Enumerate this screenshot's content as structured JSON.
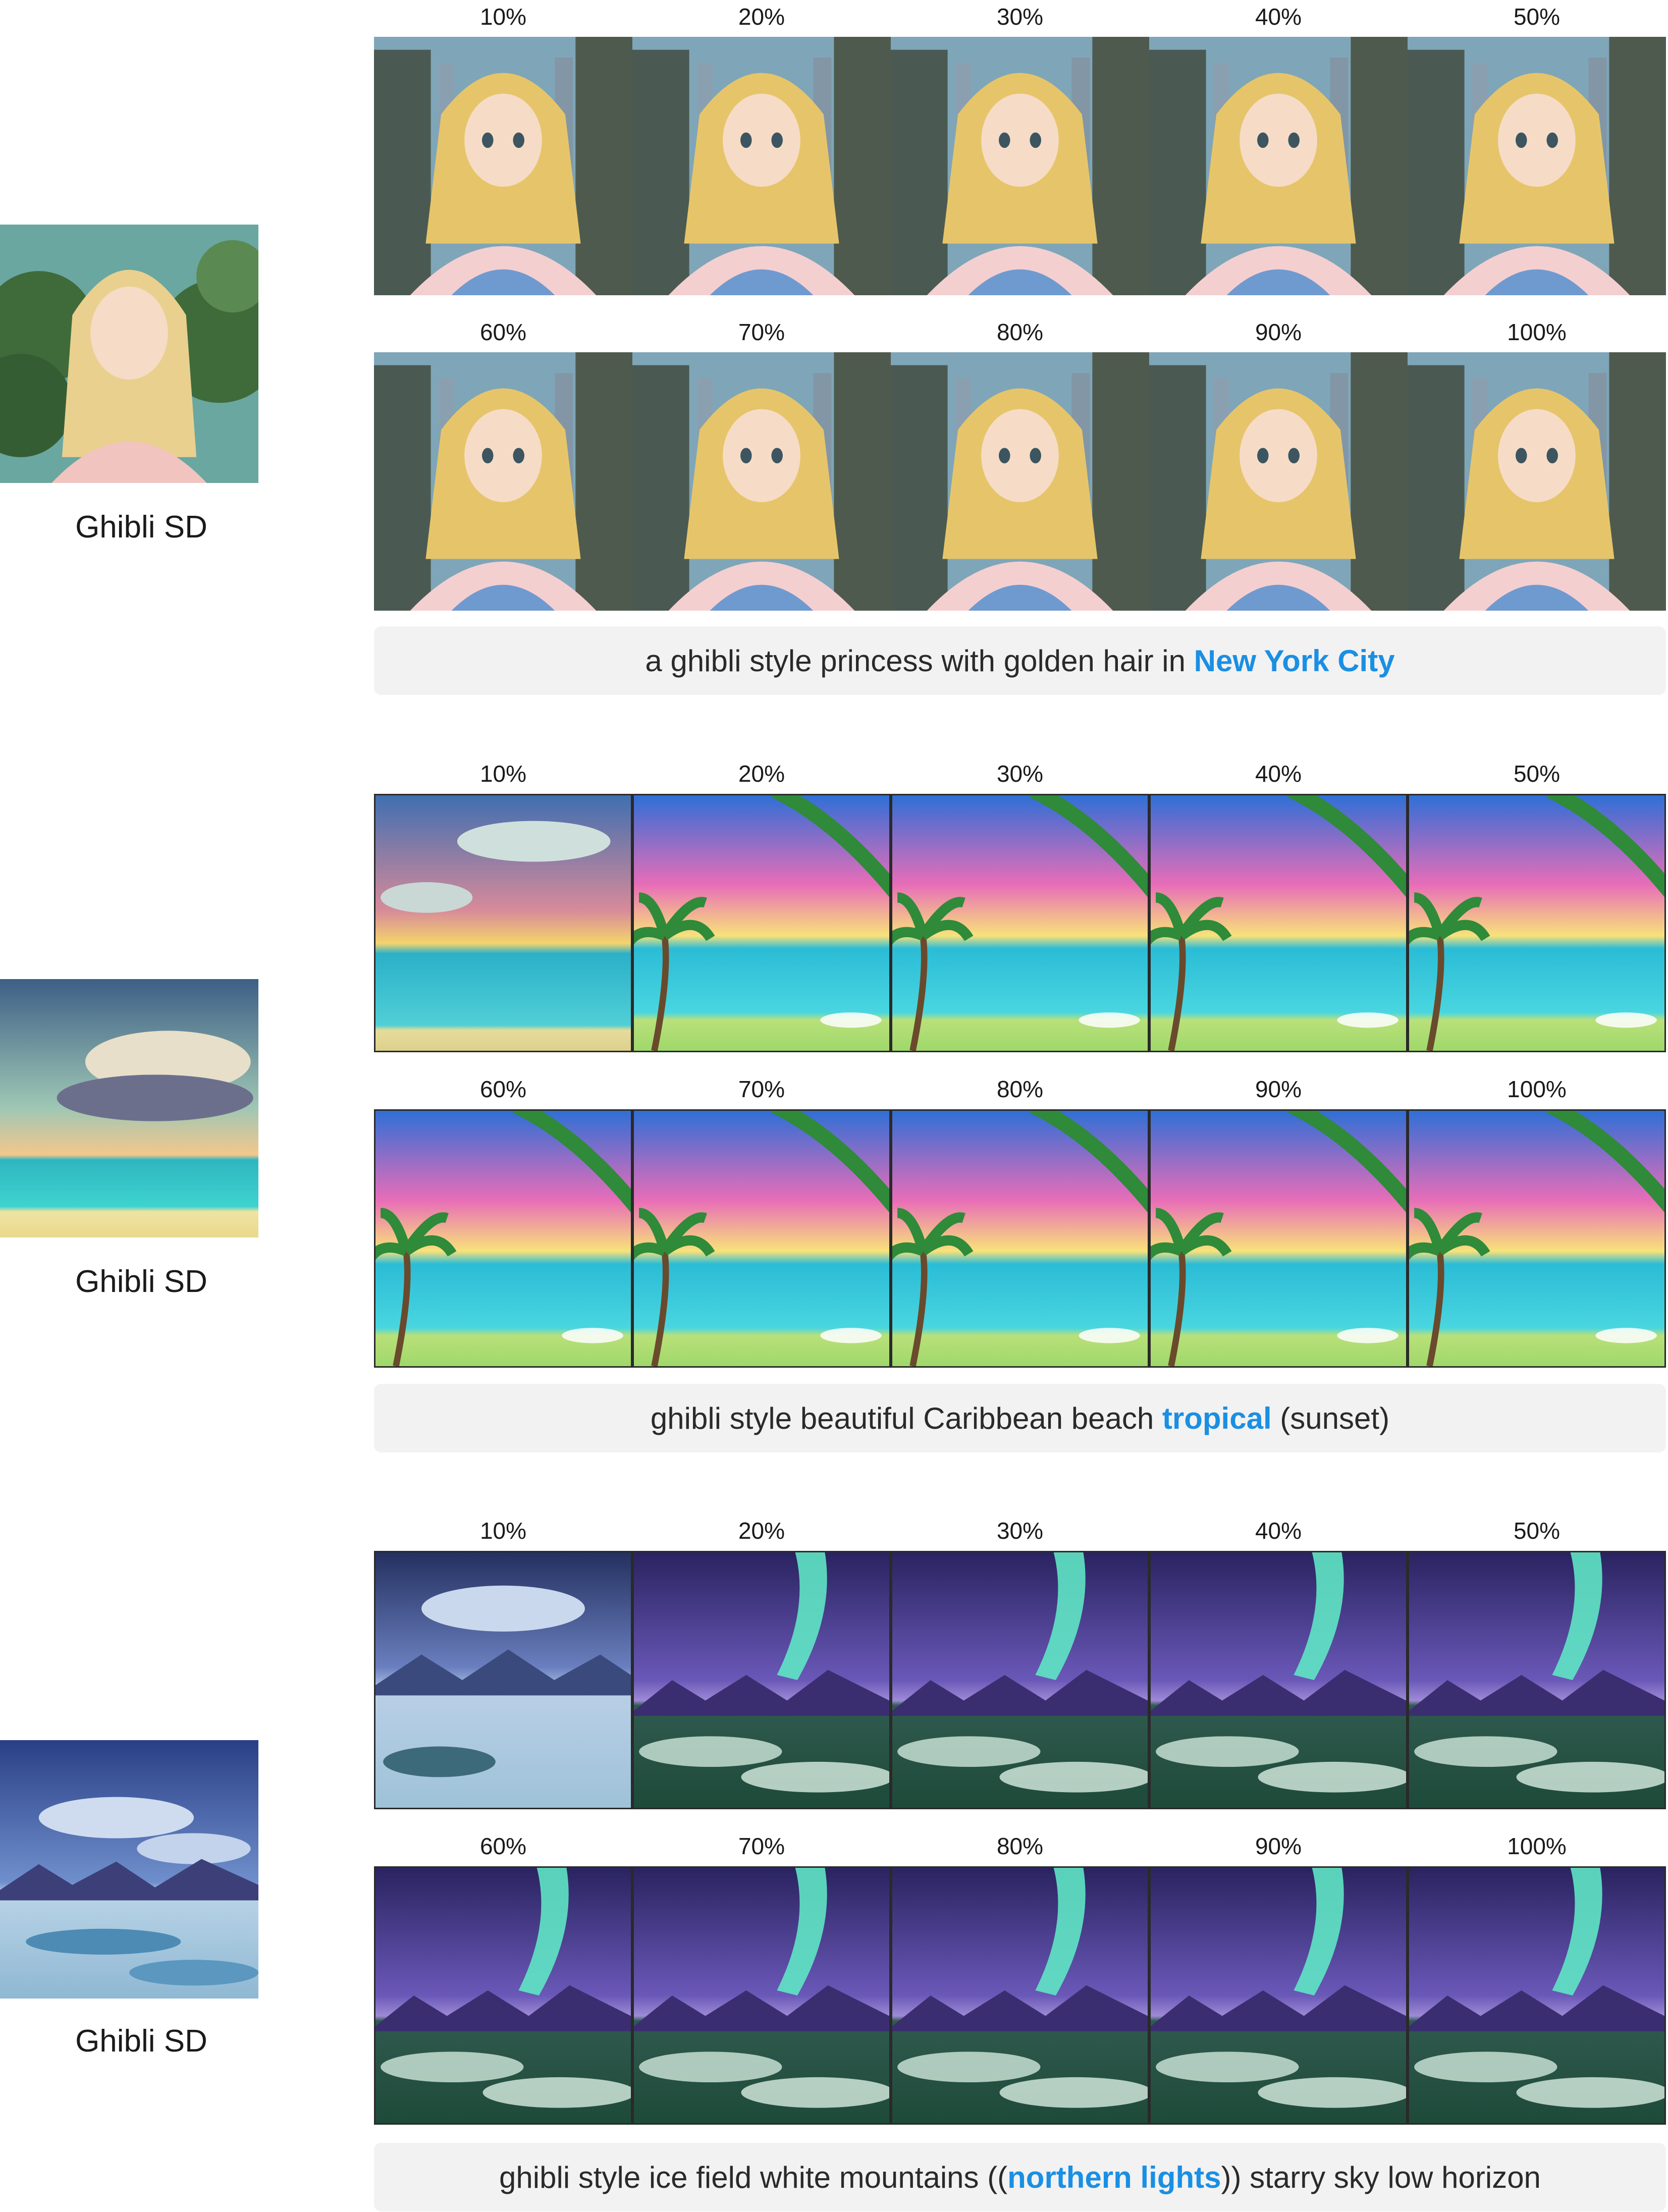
{
  "model_label": "Ghibli SD",
  "percent_labels": [
    "10%",
    "20%",
    "30%",
    "40%",
    "50%",
    "60%",
    "70%",
    "80%",
    "90%",
    "100%"
  ],
  "sections": [
    {
      "theme": "princess-city",
      "caption": {
        "before": "a ghibli style princess with golden hair in ",
        "highlight": "New York City",
        "after": ""
      }
    },
    {
      "theme": "beach-sunset",
      "caption": {
        "before": "ghibli style beautiful Caribbean beach ",
        "highlight": "tropical",
        "after": " (sunset)"
      }
    },
    {
      "theme": "ice-aurora",
      "caption": {
        "before": "ghibli style ice field white mountains ((",
        "highlight": "northern lights",
        "after": ")) starry sky low horizon"
      }
    }
  ],
  "colors": {
    "highlight": "#1a8fe3",
    "caption_bg": "#f2f2f2"
  }
}
